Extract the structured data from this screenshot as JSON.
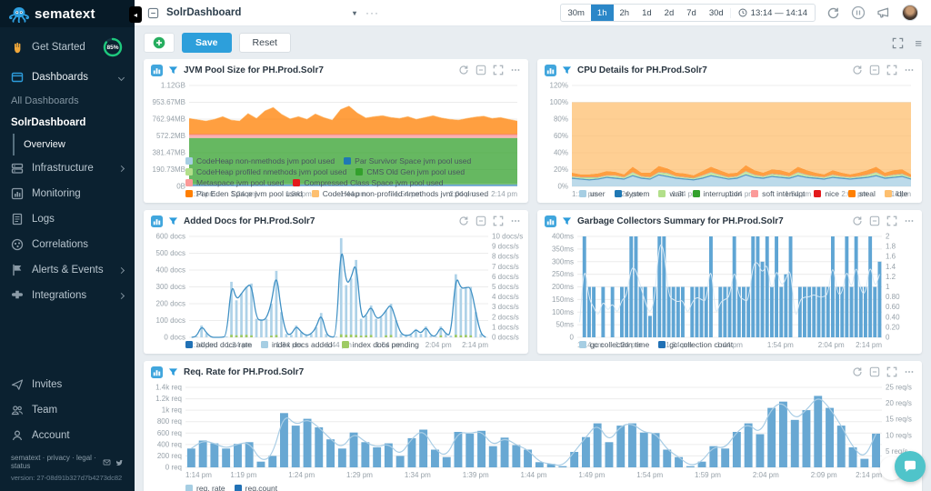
{
  "sidebar": {
    "logo": "sematext",
    "get_started": {
      "label": "Get Started",
      "progress": "85%"
    },
    "dashboards_label": "Dashboards",
    "dash_sub": {
      "all": "All Dashboards",
      "current": "SolrDashboard",
      "overview": "Overview"
    },
    "items": [
      {
        "label": "Infrastructure"
      },
      {
        "label": "Monitoring"
      },
      {
        "label": "Logs"
      },
      {
        "label": "Correlations"
      },
      {
        "label": "Alerts & Events"
      },
      {
        "label": "Integrations"
      }
    ],
    "bottom": [
      {
        "label": "Invites"
      },
      {
        "label": "Team"
      },
      {
        "label": "Account"
      }
    ],
    "footer": {
      "links": "sematext · privacy · legal · status",
      "version": "version: 27-08d91b327d7b4273dc82"
    }
  },
  "topbar": {
    "dashboard": "SolrDashboard",
    "more": "···",
    "ranges": [
      "30m",
      "1h",
      "2h",
      "1d",
      "2d",
      "7d",
      "30d"
    ],
    "selected_range": "1h",
    "window": "13:14 — 14:14"
  },
  "toolbar": {
    "save": "Save",
    "reset": "Reset"
  },
  "panels": [
    {
      "title": "JVM Pool Size for PH.Prod.Solr7"
    },
    {
      "title": "CPU Details for PH.Prod.Solr7"
    },
    {
      "title": "Added Docs for PH.Prod.Solr7"
    },
    {
      "title": "Garbage Collectors Summary for PH.Prod.Solr7"
    },
    {
      "title": "Req. Rate for PH.Prod.Solr7"
    }
  ],
  "chart_data": [
    {
      "type": "stacked-area",
      "title": "JVM Pool Size for PH.Prod.Solr7",
      "ymax": 1146.88,
      "n": 40,
      "ml": 50,
      "y_ticks_left": [
        "1.12GB",
        "953.67MB",
        "762.94MB",
        "572.2MB",
        "381.47MB",
        "190.73MB",
        "0B"
      ],
      "x_ticks": [
        "1:14 pm",
        "1:24 pm",
        "1:34 pm",
        "1:44 pm",
        "1:54 pm",
        "2:04 pm",
        "2:14 pm"
      ],
      "series": [
        {
          "name": "CodeHeap non-nmethods jvm pool used",
          "color": "#a6cee3",
          "values": 6
        },
        {
          "name": "Par Survivor Space jvm pool used",
          "color": "#1f78b4",
          "values": 16
        },
        {
          "name": "CodeHeap profiled nmethods jvm pool used",
          "color": "#b2df8a",
          "values": 3
        },
        {
          "name": "CMS Old Gen jvm pool used",
          "color": "#33a02c",
          "values": 525
        },
        {
          "name": "Metaspace jvm pool used",
          "color": "#fb9a99",
          "values": 36
        },
        {
          "name": "Compressed Class Space jvm pool used",
          "color": "#e31a1c",
          "values": 7
        },
        {
          "name": "Par Eden Space jvm pool used",
          "color": "#ff7f00",
          "values": [
            180,
            165,
            150,
            170,
            200,
            160,
            150,
            235,
            180,
            265,
            305,
            225,
            175,
            200,
            170,
            230,
            190,
            160,
            280,
            320,
            240,
            185,
            200,
            210,
            190,
            180,
            200,
            170,
            190,
            210,
            185,
            170,
            160,
            180,
            195,
            205,
            180,
            190,
            170,
            150
          ]
        },
        {
          "name": "CodeHeap non-profiled nmethods jvm pool used",
          "color": "#fdbf6f",
          "values": 5
        }
      ],
      "legend": [
        {
          "label": "CodeHeap non-nmethods jvm pool used",
          "color": "#a6cee3"
        },
        {
          "label": "Par Survivor Space jvm pool used",
          "color": "#1f78b4"
        },
        {
          "label": "CodeHeap profiled nmethods jvm pool used",
          "color": "#b2df8a"
        },
        {
          "label": "CMS Old Gen jvm pool used",
          "color": "#33a02c"
        },
        {
          "label": "Metaspace jvm pool used",
          "color": "#fb9a99"
        },
        {
          "label": "Compressed Class Space jvm pool used",
          "color": "#e31a1c"
        },
        {
          "label": "Par Eden Space jvm pool used",
          "color": "#ff7f00"
        },
        {
          "label": "CodeHeap non-profiled nmethods jvm pool used",
          "color": "#fdbf6f"
        }
      ]
    },
    {
      "type": "stacked-area",
      "title": "CPU Details for PH.Prod.Solr7",
      "ymax": 120,
      "n": 40,
      "ml": 38,
      "y_ticks_left": [
        "120%",
        "100%",
        "80%",
        "60%",
        "40%",
        "20%",
        "0%"
      ],
      "x_ticks": [
        "1:14 pm",
        "1:24 pm",
        "1:34 pm",
        "1:44 pm",
        "1:54 pm",
        "2:04 pm",
        "2:14 pm"
      ],
      "series": [
        {
          "name": "user",
          "color": "#a6cee3",
          "values": [
            9,
            8,
            7,
            8,
            10,
            9,
            8,
            12,
            9,
            8,
            13,
            11,
            9,
            8,
            7,
            9,
            12,
            10,
            8,
            9,
            13,
            10,
            9,
            11,
            10,
            9,
            12,
            10,
            9,
            8,
            10,
            9,
            8,
            9,
            10,
            12,
            9,
            10,
            11,
            8
          ]
        },
        {
          "name": "system",
          "color": "#1f78b4",
          "values": 1.5
        },
        {
          "name": "wait",
          "color": "#b2df8a",
          "values": [
            1,
            1,
            2,
            1,
            1,
            2,
            1,
            3,
            1,
            1,
            2,
            3,
            1,
            1,
            1,
            2,
            3,
            2,
            1,
            1,
            3,
            2,
            1,
            2,
            2,
            1,
            3,
            2,
            1,
            1,
            2,
            1,
            1,
            1,
            2,
            3,
            1,
            2,
            2,
            1
          ]
        },
        {
          "name": "interruption",
          "color": "#33a02c",
          "values": 0.3
        },
        {
          "name": "soft interrupt",
          "color": "#fb9a99",
          "values": 0.3
        },
        {
          "name": "nice",
          "color": "#e31a1c",
          "values": 0.2
        },
        {
          "name": "steal",
          "color": "#ff7f00",
          "values": [
            4,
            3,
            3,
            4,
            5,
            4,
            3,
            6,
            4,
            5,
            7,
            5,
            4,
            4,
            3,
            5,
            6,
            5,
            4,
            4,
            7,
            5,
            4,
            5,
            5,
            4,
            6,
            5,
            4,
            3,
            5,
            4,
            3,
            4,
            5,
            6,
            4,
            5,
            5,
            3
          ]
        },
        {
          "name": "idle",
          "color": "#fdbf6f",
          "fill_to": 100,
          "values": 0
        }
      ],
      "legend": [
        {
          "label": "user",
          "color": "#a6cee3"
        },
        {
          "label": "system",
          "color": "#1f78b4"
        },
        {
          "label": "wait",
          "color": "#b2df8a"
        },
        {
          "label": "interruption",
          "color": "#33a02c"
        },
        {
          "label": "soft interrupt",
          "color": "#fb9a99"
        },
        {
          "label": "nice",
          "color": "#e31a1c"
        },
        {
          "label": "steal",
          "color": "#ff7f00"
        },
        {
          "label": "idle",
          "color": "#fdbf6f"
        }
      ]
    },
    {
      "type": "bars-line",
      "title": "Added Docs for PH.Prod.Solr7",
      "ymax": 600,
      "ml": 50,
      "bar_width": 0.5,
      "y_ticks_left": [
        "600 docs",
        "500 docs",
        "400 docs",
        "300 docs",
        "200 docs",
        "100 docs",
        "0 docs"
      ],
      "y_ticks_right": [
        "10 docs/s",
        "9 docs/s",
        "8 docs/s",
        "7 docs/s",
        "6 docs/s",
        "5 docs/s",
        "4 docs/s",
        "3 docs/s",
        "2 docs/s",
        "1 docs/s",
        "0 docs/s"
      ],
      "x_ticks": [
        "1:14 pm",
        "1:24 pm",
        "1:34 pm",
        "1:44 pm",
        "1:54 pm",
        "2:04 pm",
        "2:14 pm"
      ],
      "bar_color": "#aed2e8",
      "bars": [
        0,
        5,
        70,
        25,
        0,
        0,
        0,
        5,
        330,
        220,
        260,
        300,
        320,
        110,
        100,
        110,
        200,
        395,
        150,
        20,
        15,
        70,
        30,
        10,
        20,
        60,
        145,
        20,
        0,
        5,
        590,
        310,
        350,
        460,
        110,
        130,
        190,
        110,
        120,
        160,
        200,
        100,
        20,
        10,
        15,
        50,
        20,
        65,
        10,
        5,
        65,
        20,
        10,
        375,
        290,
        295,
        300,
        150,
        20,
        0
      ],
      "bar2_color": "#9ecb63",
      "bars2": [
        0,
        0,
        0,
        0,
        0,
        0,
        0,
        0,
        15,
        12,
        14,
        15,
        12,
        0,
        0,
        0,
        10,
        14,
        0,
        0,
        0,
        0,
        0,
        0,
        0,
        0,
        0,
        0,
        0,
        0,
        18,
        15,
        16,
        14,
        10,
        12,
        14,
        0,
        0,
        12,
        14,
        0,
        0,
        0,
        0,
        0,
        0,
        0,
        0,
        0,
        12,
        0,
        0,
        15,
        12,
        14,
        12,
        0,
        0,
        0
      ],
      "line_from_bars": true,
      "line_color": "#3f90c4",
      "line_width": 1.3,
      "legend": [
        {
          "label": "added docs rate",
          "color": "#2171b5"
        },
        {
          "label": "index docs added",
          "color": "#a6cee3"
        },
        {
          "label": "index docs pending",
          "color": "#9ecb63"
        }
      ]
    },
    {
      "type": "bars-line",
      "title": "Garbage Collectors Summary for PH.Prod.Solr7",
      "ymax": 400,
      "ml": 44,
      "bar_width": 0.75,
      "y_ticks_left": [
        "400ms",
        "350ms",
        "300ms",
        "250ms",
        "200ms",
        "150ms",
        "100ms",
        "50ms",
        "0"
      ],
      "y_ticks_right": [
        "2",
        "1.8",
        "1.6",
        "1.4",
        "1.2",
        "1",
        "0.80",
        "0.60",
        "0.40",
        "0.20",
        "0"
      ],
      "x_ticks": [
        "1:14 pm",
        "1:24 pm",
        "1:34 pm",
        "1:44 pm",
        "1:54 pm",
        "2:04 pm",
        "2:14 pm"
      ],
      "bar_color": "#5fa5d4",
      "bars": [
        0,
        400,
        200,
        200,
        0,
        200,
        0,
        200,
        0,
        200,
        200,
        400,
        400,
        200,
        200,
        85,
        200,
        400,
        400,
        200,
        200,
        200,
        200,
        0,
        200,
        200,
        200,
        200,
        400,
        0,
        200,
        200,
        200,
        400,
        200,
        200,
        200,
        400,
        400,
        300,
        400,
        200,
        400,
        200,
        250,
        400,
        0,
        200,
        200,
        200,
        200,
        200,
        200,
        200,
        400,
        200,
        200,
        400,
        200,
        400,
        200,
        200,
        400,
        200,
        300
      ],
      "line": [
        60,
        300,
        150,
        120,
        80,
        150,
        100,
        140,
        90,
        150,
        160,
        280,
        270,
        200,
        140,
        90,
        150,
        380,
        350,
        160,
        150,
        140,
        150,
        90,
        140,
        160,
        150,
        140,
        300,
        80,
        140,
        150,
        160,
        280,
        160,
        150,
        140,
        290,
        300,
        250,
        300,
        170,
        280,
        200,
        230,
        280,
        60,
        150,
        160,
        160,
        170,
        160,
        160,
        170,
        300,
        170,
        170,
        280,
        180,
        300,
        180,
        170,
        300,
        190,
        250
      ],
      "line_color": "#d9eaf6",
      "line_width": 1,
      "legend": [
        {
          "label": "gc collection time",
          "color": "#a6cee3"
        },
        {
          "label": "gc collection count",
          "color": "#2171b5"
        }
      ]
    },
    {
      "type": "bars-line",
      "title": "Req. Rate for PH.Prod.Solr7",
      "ymax": 1400,
      "ml": 46,
      "bar_width": 0.7,
      "y_ticks_left": [
        "1.4k req",
        "1.2k req",
        "1k req",
        "800 req",
        "600 req",
        "400 req",
        "200 req",
        "0 req"
      ],
      "y_ticks_right": [
        "25 req/s",
        "20 req/s",
        "15 req/s",
        "10 req/s",
        "5 req/s",
        ""
      ],
      "x_ticks": [
        "1:14 pm",
        "1:19 pm",
        "1:24 pm",
        "1:29 pm",
        "1:34 pm",
        "1:39 pm",
        "1:44 pm",
        "1:49 pm",
        "1:54 pm",
        "1:59 pm",
        "2:04 pm",
        "2:09 pm",
        "2:14 pm"
      ],
      "bar_color": "#68a8d3",
      "bars": [
        330,
        470,
        420,
        330,
        410,
        440,
        100,
        200,
        950,
        730,
        850,
        700,
        490,
        330,
        610,
        440,
        350,
        420,
        200,
        510,
        660,
        310,
        180,
        620,
        590,
        640,
        370,
        520,
        390,
        310,
        90,
        60,
        20,
        270,
        530,
        770,
        440,
        730,
        770,
        610,
        600,
        310,
        180,
        20,
        100,
        370,
        330,
        620,
        770,
        580,
        1040,
        1150,
        830,
        1000,
        1250,
        1040,
        730,
        350,
        150,
        590
      ],
      "line_from_bars": true,
      "line_color": "#a9cde5",
      "line_width": 1.2,
      "legend": [
        {
          "label": "req. rate",
          "color": "#a6cee3"
        },
        {
          "label": "req.count",
          "color": "#2171b5"
        }
      ]
    }
  ]
}
